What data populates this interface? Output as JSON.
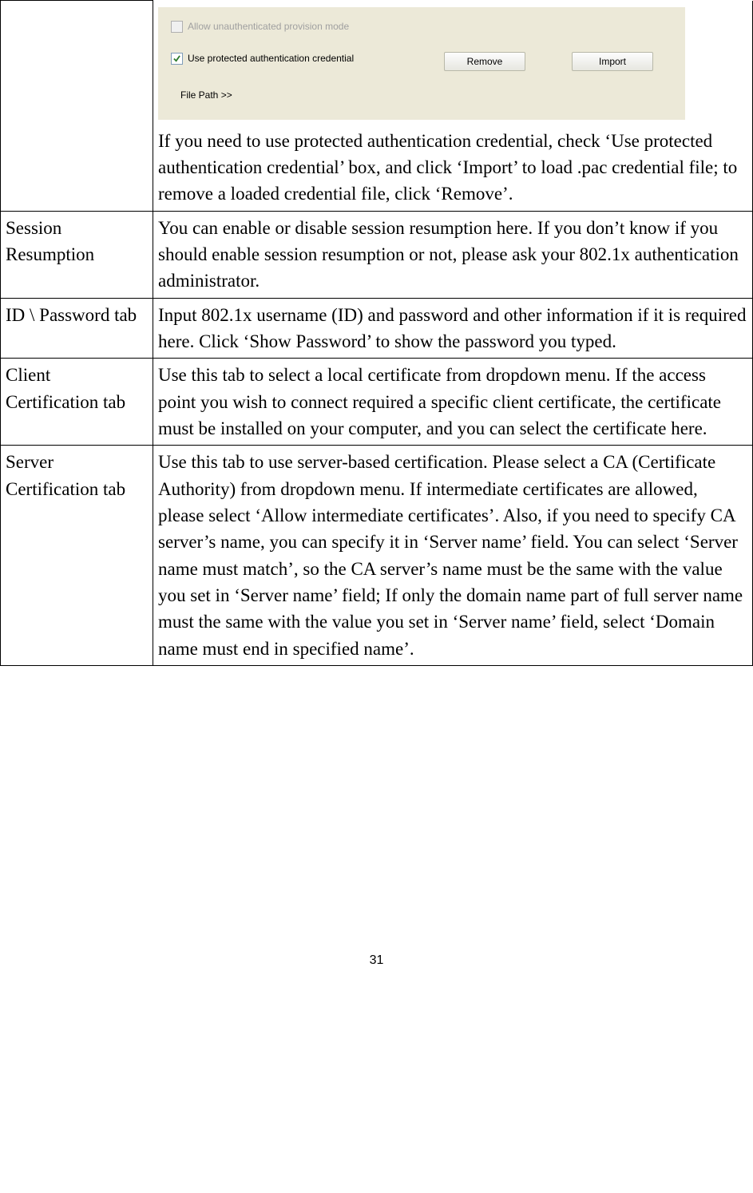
{
  "screenshot": {
    "checkbox1": {
      "label": "Allow unauthenticated provision mode",
      "checked": false,
      "disabled": true
    },
    "checkbox2": {
      "label": "Use protected authentication credential",
      "checked": true,
      "disabled": false
    },
    "remove_btn": "Remove",
    "import_btn": "Import",
    "file_path_label": "File Path >>"
  },
  "row0": {
    "desc": "If you need to use protected authentication credential, check ‘Use protected authentication credential’ box, and click ‘Import’ to load .pac credential file; to remove a loaded credential file, click ‘Remove’."
  },
  "rows": [
    {
      "label": "Session Resumption",
      "desc": "You can enable or disable session resumption here. If you don’t know if you should enable session resumption or not, please ask your 802.1x authentication administrator."
    },
    {
      "label": "ID \\ Password tab",
      "desc": "Input 802.1x username (ID) and password and other information if it is required here. Click ‘Show Password’ to show the password you typed."
    },
    {
      "label": "Client Certification tab",
      "desc": "Use this tab to select a local certificate from dropdown menu. If the access point you wish to connect required a specific client certificate, the certificate must be installed on your computer, and you can select the certificate here."
    },
    {
      "label": "Server Certification tab",
      "desc": "Use this tab to use server-based certification. Please select a CA (Certificate Authority) from dropdown menu. If intermediate certificates are allowed, please select ‘Allow intermediate certificates’. Also, if you need to specify CA server’s name, you can specify it in ‘Server name’ field. You can select ‘Server name must match’, so the CA server’s name must be the same with the value you set in ‘Server name’ field; If only the domain name part of full server name must the same with the value you set in ‘Server name’ field, select ‘Domain name must end in specified name’."
    }
  ],
  "page_number": "31"
}
